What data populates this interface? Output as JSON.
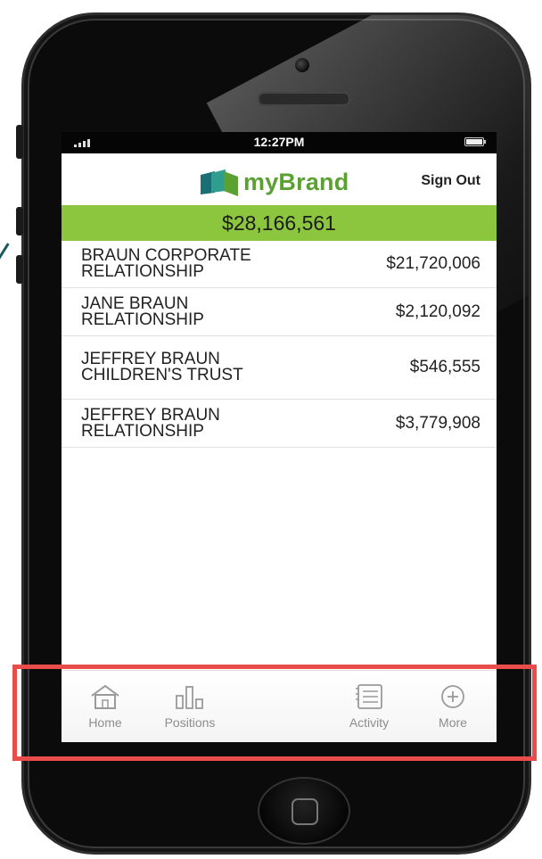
{
  "status_bar": {
    "time": "12:27PM"
  },
  "header": {
    "brand": "myBrand",
    "sign_out_label": "Sign Out"
  },
  "total_value": "$28,166,561",
  "accounts": [
    {
      "name": "BRAUN CORPORATE RELATIONSHIP",
      "value": "$21,720,006"
    },
    {
      "name": "JANE BRAUN RELATIONSHIP",
      "value": "$2,120,092"
    },
    {
      "name": "JEFFREY BRAUN CHILDREN'S TRUST",
      "value": "$546,555"
    },
    {
      "name": "JEFFREY BRAUN RELATIONSHIP",
      "value": "$3,779,908"
    }
  ],
  "tab_bar": {
    "items": [
      {
        "label": "Home",
        "icon": "home-icon"
      },
      {
        "label": "Positions",
        "icon": "bar-chart-icon"
      },
      {
        "label": "Activity",
        "icon": "list-icon"
      },
      {
        "label": "More",
        "icon": "plus-circle-icon"
      }
    ]
  },
  "colors": {
    "brand_green": "#5aa131",
    "total_bar": "#8cc63f",
    "highlight": "#ea4b4b",
    "logo_teal": "#1a6f74",
    "tab_icon": "#9a9a9a"
  }
}
